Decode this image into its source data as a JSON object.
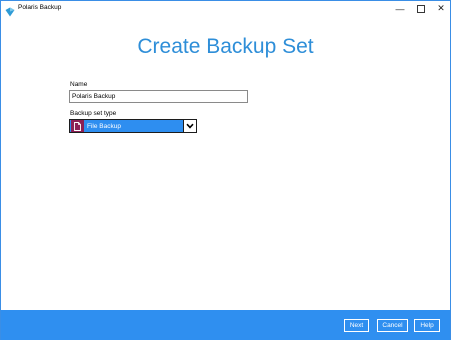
{
  "window": {
    "title": "Polaris Backup",
    "minimize": "—",
    "maximize": "☐",
    "close": "✕"
  },
  "page": {
    "title": "Create Backup Set"
  },
  "form": {
    "name_label": "Name",
    "name_value": "Polaris Backup",
    "type_label": "Backup set type",
    "type_value": "File Backup"
  },
  "footer": {
    "next_label": "Next",
    "cancel_label": "Cancel",
    "help_label": "Help"
  },
  "colors": {
    "accent": "#2e8ed8",
    "footer_bg": "#2f8ff0",
    "selected_bg": "#2e8ef0",
    "file_icon_bg": "#8c1f55"
  },
  "icons": {
    "app": "polaris-logo-icon",
    "file_type": "file-icon",
    "dropdown": "chevron-down-icon"
  }
}
